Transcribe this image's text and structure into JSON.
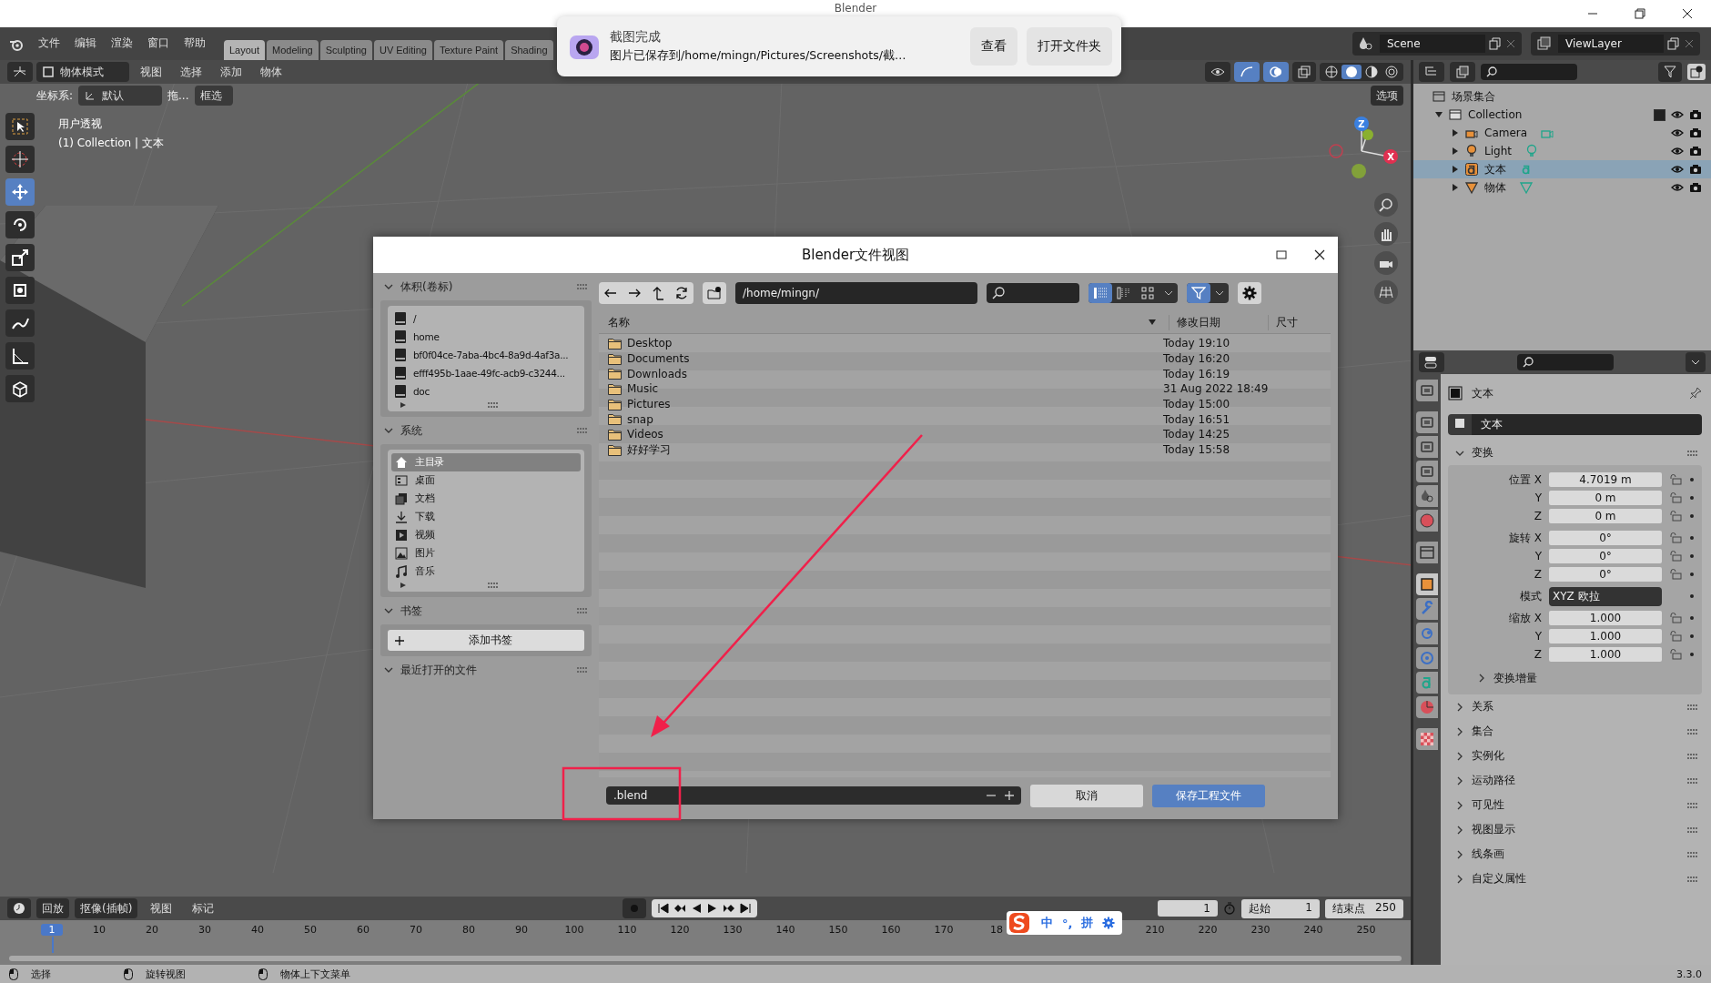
{
  "window": {
    "title": "Blender"
  },
  "menu": [
    "文件",
    "编辑",
    "渲染",
    "窗口",
    "帮助"
  ],
  "workspaces": [
    {
      "label": "Layout",
      "selected": true
    },
    {
      "label": "Modeling",
      "selected": false
    },
    {
      "label": "Sculpting",
      "selected": false
    },
    {
      "label": "UV Editing",
      "selected": false
    },
    {
      "label": "Texture Paint",
      "selected": false
    },
    {
      "label": "Shading",
      "selected": false
    }
  ],
  "scene": "Scene",
  "view_layer": "ViewLayer",
  "viewport": {
    "mode": "物体模式",
    "menus": [
      "视图",
      "选择",
      "添加",
      "物体"
    ],
    "orientation_label": "坐标系:",
    "orientation": "默认",
    "drag_label": "拖...",
    "drag": "框选",
    "options": "选项",
    "view_name": "用户透视",
    "context": "(1) Collection | 文本",
    "tools": [
      {
        "kind": "select",
        "selected": false
      },
      {
        "kind": "cursor",
        "selected": false
      },
      {
        "kind": "move",
        "selected": true
      },
      {
        "kind": "rotate",
        "selected": false
      },
      {
        "kind": "scale",
        "selected": false
      },
      {
        "kind": "transform",
        "selected": false
      },
      {
        "kind": "annotate",
        "selected": false
      },
      {
        "kind": "measure",
        "selected": false
      },
      {
        "kind": "add-cube",
        "selected": false
      }
    ],
    "shading": [
      {
        "kind": "wireframe",
        "selected": false
      },
      {
        "kind": "solid",
        "selected": true
      },
      {
        "kind": "material",
        "selected": false
      },
      {
        "kind": "rendered",
        "selected": false
      }
    ],
    "gizmo": [
      "Z",
      "X"
    ]
  },
  "outliner": {
    "tree": [
      {
        "label": "场景集合",
        "kind": "scene",
        "selected": false,
        "children": [
          {
            "label": "Collection",
            "kind": "collection",
            "expanded": true,
            "checked": true,
            "selected": false,
            "children": [
              {
                "label": "Camera",
                "kind": "camera",
                "expanded": false,
                "selected": false
              },
              {
                "label": "Light",
                "kind": "light",
                "expanded": false,
                "selected": false
              },
              {
                "label": "文本",
                "kind": "text",
                "expanded": false,
                "selected": true
              },
              {
                "label": "物体",
                "kind": "mesh",
                "expanded": false,
                "selected": false
              }
            ]
          }
        ]
      }
    ]
  },
  "properties": {
    "tabs": [
      {
        "kind": "tool",
        "selected": false
      },
      {
        "kind": "render",
        "selected": false
      },
      {
        "kind": "output",
        "selected": false
      },
      {
        "kind": "view-layer",
        "selected": false
      },
      {
        "kind": "scene",
        "selected": false
      },
      {
        "kind": "world",
        "selected": false
      },
      {
        "kind": "collection",
        "selected": false
      },
      {
        "kind": "object",
        "selected": true
      },
      {
        "kind": "modifier",
        "selected": false
      },
      {
        "kind": "particles",
        "selected": false
      },
      {
        "kind": "physics",
        "selected": false
      },
      {
        "kind": "data",
        "selected": false
      },
      {
        "kind": "material",
        "selected": false
      },
      {
        "kind": "texture",
        "selected": false
      }
    ],
    "object": "文本",
    "name": "文本",
    "transform": {
      "title": "变换",
      "expanded": true,
      "rows": [
        {
          "label": "位置",
          "axis": "X",
          "value": "4.7019 m",
          "kind": "number",
          "group_start": true
        },
        {
          "axis": "Y",
          "value": "0 m",
          "kind": "number",
          "group_start": false
        },
        {
          "axis": "Z",
          "value": "0 m",
          "kind": "number",
          "group_start": false
        },
        {
          "label": "旋转",
          "axis": "X",
          "value": "0°",
          "kind": "number",
          "group_start": true
        },
        {
          "axis": "Y",
          "value": "0°",
          "kind": "number",
          "group_start": false
        },
        {
          "axis": "Z",
          "value": "0°",
          "kind": "number",
          "group_start": false
        },
        {
          "label": "模式",
          "value": "XYZ 欧拉",
          "kind": "dropdown",
          "group_start": true
        },
        {
          "label": "缩放",
          "axis": "X",
          "value": "1.000",
          "kind": "number",
          "group_start": true
        },
        {
          "axis": "Y",
          "value": "1.000",
          "kind": "number",
          "group_start": false
        },
        {
          "axis": "Z",
          "value": "1.000",
          "kind": "number",
          "group_start": false
        }
      ],
      "subpanel": {
        "title": "变换增量",
        "expanded": false
      }
    },
    "panels": [
      {
        "title": "关系",
        "expanded": false
      },
      {
        "title": "集合",
        "expanded": false
      },
      {
        "title": "实例化",
        "expanded": false
      },
      {
        "title": "运动路径",
        "expanded": false
      },
      {
        "title": "可见性",
        "expanded": false
      },
      {
        "title": "视图显示",
        "expanded": false
      },
      {
        "title": "线条画",
        "expanded": false
      },
      {
        "title": "自定义属性",
        "expanded": false
      }
    ]
  },
  "timeline": {
    "menus": [
      "回放",
      "抠像(插帧)",
      "视图",
      "标记"
    ],
    "current_frame": "1",
    "start_label": "起始",
    "start": "1",
    "end_label": "结束点",
    "end": "250",
    "ruler": [
      [
        {
          "label": "1",
          "current": true
        },
        {
          "label": "10",
          "current": false
        },
        {
          "label": "20",
          "current": false
        },
        {
          "label": "30",
          "current": false
        },
        {
          "label": "40",
          "current": false
        },
        {
          "label": "50",
          "current": false
        },
        {
          "label": "60",
          "current": false
        },
        {
          "label": "70",
          "current": false
        },
        {
          "label": "80",
          "current": false
        },
        {
          "label": "90",
          "current": false
        },
        {
          "label": "100",
          "current": false
        },
        {
          "label": "110",
          "current": false
        },
        {
          "label": "120",
          "current": false
        },
        {
          "label": "130",
          "current": false
        },
        {
          "label": "140",
          "current": false
        },
        {
          "label": "150",
          "current": false
        },
        {
          "label": "160",
          "current": false
        },
        {
          "label": "170",
          "current": false
        },
        {
          "label": "18",
          "current": false
        }
      ],
      [
        {
          "label": "210",
          "current": false
        },
        {
          "label": "220",
          "current": false
        },
        {
          "label": "230",
          "current": false
        },
        {
          "label": "240",
          "current": false
        },
        {
          "label": "250",
          "current": false
        }
      ]
    ]
  },
  "status_bar": {
    "hints": [
      "选择",
      "旋转视图",
      "物体上下文菜单"
    ],
    "version": "3.3.0"
  },
  "dialog": {
    "title": "Blender文件视图",
    "volumes": {
      "title": "体积(卷标)",
      "expanded": true,
      "items": [
        "/",
        "home",
        "bf0f04ce-7aba-4bc4-8a9d-4af3a...",
        "efff495b-1aae-49fc-acb9-c3244...",
        "doc"
      ]
    },
    "system": {
      "title": "系统",
      "expanded": true,
      "items": [
        {
          "label": "主目录",
          "kind": "home",
          "selected": true
        },
        {
          "label": "桌面",
          "kind": "desktop",
          "selected": false
        },
        {
          "label": "文档",
          "kind": "documents",
          "selected": false
        },
        {
          "label": "下载",
          "kind": "download",
          "selected": false
        },
        {
          "label": "视频",
          "kind": "video",
          "selected": false
        },
        {
          "label": "图片",
          "kind": "image",
          "selected": false
        },
        {
          "label": "音乐",
          "kind": "music",
          "selected": false
        }
      ]
    },
    "bookmarks": {
      "title": "书签",
      "expanded": true,
      "button": "添加书签"
    },
    "recent": {
      "title": "最近打开的文件",
      "expanded": true
    },
    "path": "/home/mingn/",
    "view_modes": [
      {
        "kind": "list-vertical",
        "selected": true
      },
      {
        "kind": "list-horizontal",
        "selected": false
      },
      {
        "kind": "thumbnails",
        "selected": false
      }
    ],
    "filter_on": true,
    "columns": [
      "名称",
      "修改日期",
      "尺寸"
    ],
    "files": [
      {
        "name": "Desktop",
        "date": "Today 19:10"
      },
      {
        "name": "Documents",
        "date": "Today 16:20"
      },
      {
        "name": "Downloads",
        "date": "Today 16:19"
      },
      {
        "name": "Music",
        "date": "31 Aug 2022 18:49"
      },
      {
        "name": "Pictures",
        "date": "Today 15:00"
      },
      {
        "name": "snap",
        "date": "Today 16:51"
      },
      {
        "name": "Videos",
        "date": "Today 14:25"
      },
      {
        "name": "好好学习",
        "date": "Today 15:58"
      }
    ],
    "filename": ".blend",
    "cancel": "取消",
    "confirm": "保存工程文件"
  },
  "notification": {
    "title": "截图完成",
    "message": "图片已保存到/home/mingn/Pictures/Screenshots/截…",
    "buttons": [
      "查看",
      "打开文件夹"
    ]
  },
  "ime": {
    "labels": [
      "中",
      "°,",
      "拼"
    ]
  }
}
